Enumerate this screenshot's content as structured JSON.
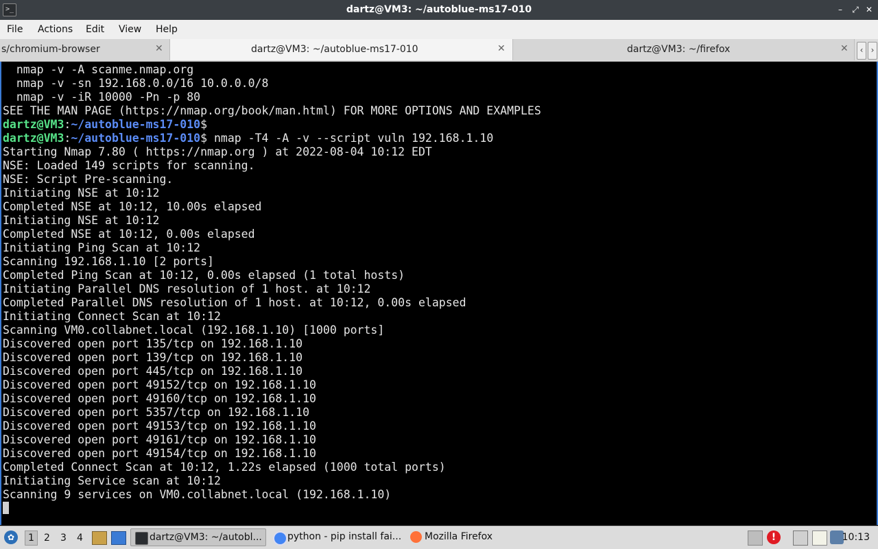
{
  "window": {
    "title": "dartz@VM3: ~/autoblue-ms17-010",
    "icon": "terminal-icon",
    "controls": [
      "minimize",
      "maximize",
      "close"
    ],
    "controls_glyphs": [
      "–",
      "⤢",
      "✕"
    ]
  },
  "menu": [
    "File",
    "Actions",
    "Edit",
    "View",
    "Help"
  ],
  "tabs": [
    {
      "label": "s/chromium-browser",
      "active": false
    },
    {
      "label": "dartz@VM3: ~/autoblue-ms17-010",
      "active": true
    },
    {
      "label": "dartz@VM3: ~/firefox",
      "active": false
    }
  ],
  "tab_close": "✕",
  "tab_nav": [
    "‹",
    "›"
  ],
  "terminal": {
    "lines": [
      {
        "text": "  nmap -v -A scanme.nmap.org"
      },
      {
        "text": "  nmap -v -sn 192.168.0.0/16 10.0.0.0/8"
      },
      {
        "text": "  nmap -v -iR 10000 -Pn -p 80"
      },
      {
        "text": "SEE THE MAN PAGE (https://nmap.org/book/man.html) FOR MORE OPTIONS AND EXAMPLES"
      },
      {
        "prompt": {
          "user": "dartz@VM3",
          "colon": ":",
          "path": "~/autoblue-ms17-010",
          "sign": "$"
        },
        "cmd": ""
      },
      {
        "prompt": {
          "user": "dartz@VM3",
          "colon": ":",
          "path": "~/autoblue-ms17-010",
          "sign": "$"
        },
        "cmd": " nmap -T4 -A -v --script vuln 192.168.1.10"
      },
      {
        "text": "Starting Nmap 7.80 ( https://nmap.org ) at 2022-08-04 10:12 EDT"
      },
      {
        "text": "NSE: Loaded 149 scripts for scanning."
      },
      {
        "text": "NSE: Script Pre-scanning."
      },
      {
        "text": "Initiating NSE at 10:12"
      },
      {
        "text": "Completed NSE at 10:12, 10.00s elapsed"
      },
      {
        "text": "Initiating NSE at 10:12"
      },
      {
        "text": "Completed NSE at 10:12, 0.00s elapsed"
      },
      {
        "text": "Initiating Ping Scan at 10:12"
      },
      {
        "text": "Scanning 192.168.1.10 [2 ports]"
      },
      {
        "text": "Completed Ping Scan at 10:12, 0.00s elapsed (1 total hosts)"
      },
      {
        "text": "Initiating Parallel DNS resolution of 1 host. at 10:12"
      },
      {
        "text": "Completed Parallel DNS resolution of 1 host. at 10:12, 0.00s elapsed"
      },
      {
        "text": "Initiating Connect Scan at 10:12"
      },
      {
        "text": "Scanning VM0.collabnet.local (192.168.1.10) [1000 ports]"
      },
      {
        "text": "Discovered open port 135/tcp on 192.168.1.10"
      },
      {
        "text": "Discovered open port 139/tcp on 192.168.1.10"
      },
      {
        "text": "Discovered open port 445/tcp on 192.168.1.10"
      },
      {
        "text": "Discovered open port 49152/tcp on 192.168.1.10"
      },
      {
        "text": "Discovered open port 49160/tcp on 192.168.1.10"
      },
      {
        "text": "Discovered open port 5357/tcp on 192.168.1.10"
      },
      {
        "text": "Discovered open port 49153/tcp on 192.168.1.10"
      },
      {
        "text": "Discovered open port 49161/tcp on 192.168.1.10"
      },
      {
        "text": "Discovered open port 49154/tcp on 192.168.1.10"
      },
      {
        "text": "Completed Connect Scan at 10:12, 1.22s elapsed (1000 total ports)"
      },
      {
        "text": "Initiating Service scan at 10:12"
      },
      {
        "text": "Scanning 9 services on VM0.collabnet.local (192.168.1.10)"
      }
    ]
  },
  "taskbar": {
    "workspaces": [
      "1",
      "2",
      "3",
      "4"
    ],
    "active_workspace": "1",
    "tasks": [
      {
        "label": "dartz@VM3: ~/autobl...",
        "icon": "terminal-icon",
        "active": true
      },
      {
        "label": "python - pip install fai...",
        "icon": "chromium-icon",
        "active": false
      },
      {
        "label": "Mozilla Firefox",
        "icon": "firefox-icon",
        "active": false
      }
    ],
    "clock": "10:13"
  },
  "colors": {
    "prompt_user": "#57e389",
    "prompt_path": "#5b8cf7",
    "terminal_bg": "#000000",
    "terminal_fg": "#e6e6e6",
    "alert": "#e01b24"
  }
}
